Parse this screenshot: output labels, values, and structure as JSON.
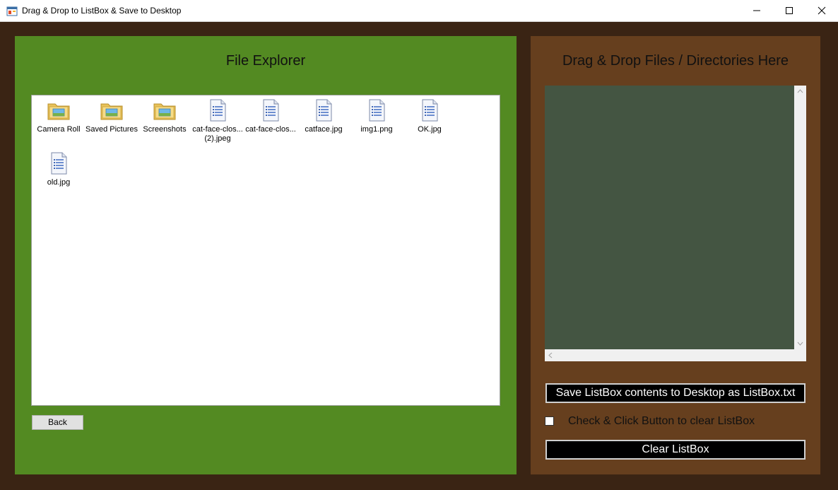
{
  "window": {
    "title": "Drag & Drop to ListBox & Save to Desktop",
    "icon": "app-form-icon"
  },
  "controls": {
    "minimize": "minimize-icon",
    "maximize": "maximize-icon",
    "close": "close-icon"
  },
  "left_panel": {
    "title": "File Explorer",
    "back_label": "Back",
    "background": "#538a22"
  },
  "files": [
    {
      "label": "Camera Roll",
      "type": "folder"
    },
    {
      "label": "Saved Pictures",
      "type": "folder"
    },
    {
      "label": "Screenshots",
      "type": "folder"
    },
    {
      "label": "cat-face-clos... (2).jpeg",
      "type": "file"
    },
    {
      "label": "cat-face-clos...",
      "type": "file"
    },
    {
      "label": "catface.jpg",
      "type": "file"
    },
    {
      "label": "img1.png",
      "type": "file"
    },
    {
      "label": "OK.jpg",
      "type": "file"
    },
    {
      "label": "old.jpg",
      "type": "file"
    }
  ],
  "right_panel": {
    "title": "Drag & Drop Files / Directories Here",
    "save_label": "Save ListBox contents to Desktop as ListBox.txt",
    "checkbox_label": "Check & Click Button to clear ListBox",
    "clear_label": "Clear ListBox",
    "background": "#663f1e",
    "listbox_background": "#445542"
  }
}
